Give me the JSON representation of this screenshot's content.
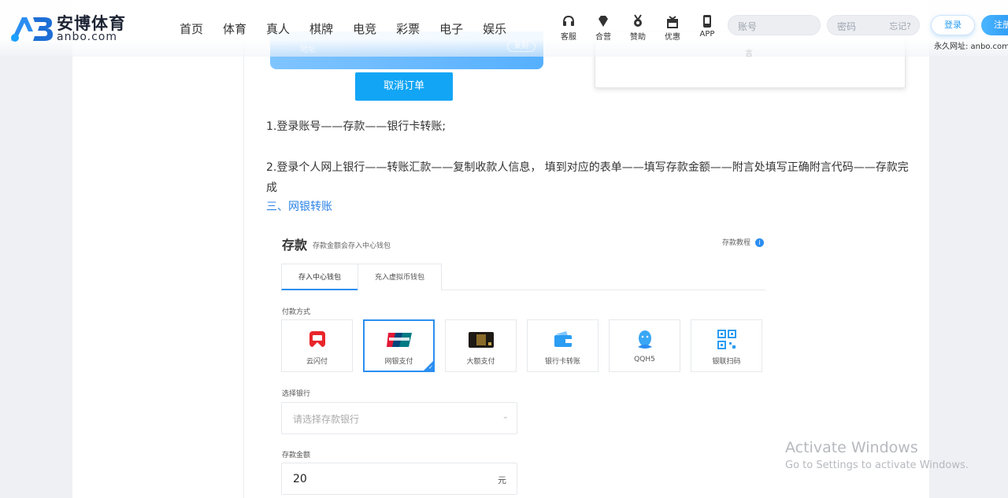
{
  "header": {
    "logo_name": "安博体育",
    "logo_domain": "anbo.com",
    "nav": [
      "首页",
      "体育",
      "真人",
      "棋牌",
      "电竞",
      "彩票",
      "电子",
      "娱乐"
    ],
    "quick": [
      {
        "label": "客服",
        "icon": "headset-icon"
      },
      {
        "label": "合营",
        "icon": "diamond-icon"
      },
      {
        "label": "赞助",
        "icon": "medal-icon"
      },
      {
        "label": "优惠",
        "icon": "gift-icon"
      },
      {
        "label": "APP",
        "icon": "app-icon"
      }
    ],
    "account_placeholder": "账号",
    "password_placeholder": "密码",
    "forgot": "忘记?",
    "login": "登录",
    "register": "注册",
    "permanent_url": "永久网址: anbo.com"
  },
  "top": {
    "card_label": "地址",
    "copy": "复制",
    "cancel_order": "取消订单",
    "right_box_text": "言"
  },
  "article": {
    "step1": "1.登录账号——存款——银行卡转账;",
    "step2": "2.登录个人网上银行——转账汇款——复制收款人信息， 填到对应的表单——填写存款金额——附言处填写正确附言代码——存款完成",
    "section3": "三、网银转账"
  },
  "deposit": {
    "title": "存款",
    "subtitle": "存款金额会存入中心钱包",
    "tutorial": "存款教程",
    "tabs": [
      "存入中心钱包",
      "充入虚拟币钱包"
    ],
    "payment_label": "付款方式",
    "methods": [
      {
        "name": "云闪付",
        "icon": "unionpay-quickpass-icon"
      },
      {
        "name": "网银支付",
        "icon": "unionpay-icon",
        "selected": true
      },
      {
        "name": "大额支付",
        "icon": "bank-card-icon"
      },
      {
        "name": "银行卡转账",
        "icon": "wallet-icon"
      },
      {
        "name": "QQH5",
        "icon": "qq-penguin-icon"
      },
      {
        "name": "银联扫码",
        "icon": "qr-scan-icon"
      }
    ],
    "bank_label": "选择银行",
    "bank_placeholder": "请选择存款银行",
    "amount_label": "存款金额",
    "amount_value": "20",
    "amount_unit": "元"
  },
  "watermark": {
    "line1": "Activate Windows",
    "line2": "Go to Settings to activate Windows."
  },
  "colors": {
    "accent": "#2b8ef0",
    "button": "#12a5f5",
    "link": "#2b82e8"
  }
}
